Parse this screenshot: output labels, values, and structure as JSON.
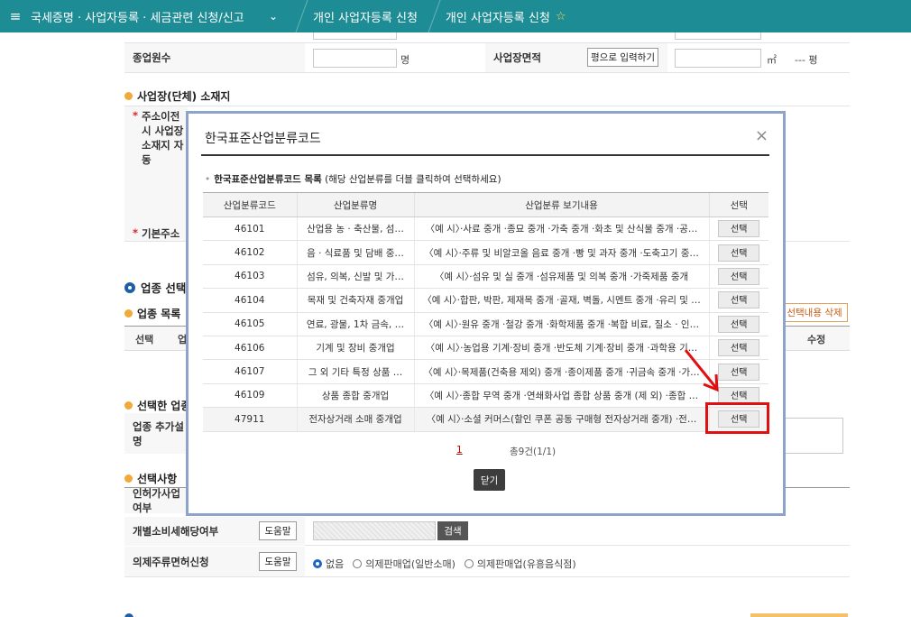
{
  "topnav": {
    "crumb1": "국세증명 · 사업자등록 · 세금관련 신청/신고",
    "crumb2": "개인 사업자등록 신청",
    "crumb3": "개인 사업자등록 신청"
  },
  "form": {
    "employees_label": "종업원수",
    "employees_unit": "명",
    "area_label": "사업장면적",
    "area_btn": "평으로 입력하기",
    "area_unit": "㎡",
    "area_py": "--- 평",
    "location_title": "사업장(단체) 소재지",
    "move_addr_label_1": "주소이전시 사업장",
    "move_addr_label_2": "소재지 자동",
    "basic_addr_label": "기본주소",
    "biz_select_title": "업종 선택",
    "biz_list_title": "업종 목록",
    "col_select": "선택",
    "col_biz": "업",
    "col_edit": "수정",
    "delete_btn": "선택내용 삭제",
    "selected_biz_title": "선택한 업종",
    "biz_extra_label": "업종 추가설명",
    "selection_title": "선택사항",
    "permit_label": "인허가사업여부",
    "excise_label": "개별소비세해당여부",
    "help_btn": "도움말",
    "search_btn": "검색",
    "liquor_label": "의제주류면허신청",
    "radio_none": "없음",
    "radio_retail": "의제판매업(일반소매)",
    "radio_bar": "의제판매업(유흥음식점)"
  },
  "modal": {
    "title": "한국표준산업분류코드",
    "close": "×",
    "subtitle_bold": "한국표준산업분류코드 목록",
    "subtitle_rest": "(해당 산업분류를 더블 클릭하여 선택하세요)",
    "headers": [
      "산업분류코드",
      "산업분류명",
      "산업분류 보기내용",
      "선택"
    ],
    "select_label": "선택",
    "rows": [
      {
        "code": "46101",
        "name": "산업용 농 · 축산물, 섬…",
        "desc": "〈예 시〉·사료 중개 ·종묘 중개 ·가축 중개 ·화초 및 산식물 중개 ·공…"
      },
      {
        "code": "46102",
        "name": "음 · 식료품 및 담배 중…",
        "desc": "〈예 시〉·주류 및 비알코올 음료 중개 ·빵 및 과자 중개 ·도축고기 중…"
      },
      {
        "code": "46103",
        "name": "섬유, 의복, 신발 및 가…",
        "desc": "〈예 시〉·섬유 및 실 중개 ·섬유제품 및 의복 중개 ·가죽제품 중개"
      },
      {
        "code": "46104",
        "name": "목재 및 건축자재 중개업",
        "desc": "〈예 시〉·합판, 박판, 제재목 중개 ·골재, 벽돌, 시멘트 중개 ·유리 및 …"
      },
      {
        "code": "46105",
        "name": "연료, 광물, 1차 금속, …",
        "desc": "〈예 시〉·원유 중개 ·철강 중개 ·화학제품 중개 ·복합 비료, 질소 · 인…"
      },
      {
        "code": "46106",
        "name": "기계 및 장비 중개업",
        "desc": "〈예 시〉·농업용 기계·장비 중개 ·반도체 기계·장비 중개 ·과학용 기…"
      },
      {
        "code": "46107",
        "name": "그 외 기타 특정 상품 …",
        "desc": "〈예 시〉·목제품(건축용 제외) 중개 ·종이제품 중개 ·귀금속 중개 ·가…"
      },
      {
        "code": "46109",
        "name": "상품 종합 중개업",
        "desc": "〈예 시〉·종합 무역 중개 ·연쇄화사업 종합 상품 중개 (제 외) ·종합 …"
      },
      {
        "code": "47911",
        "name": "전자상거래 소매 중개업",
        "desc": "〈예 시〉·소셜 커머스(할인 쿠폰 공동 구매형 전자상거래 중개) ·전…"
      }
    ],
    "page": "1",
    "total": "총9건(1/1)",
    "close_btn": "닫기"
  }
}
